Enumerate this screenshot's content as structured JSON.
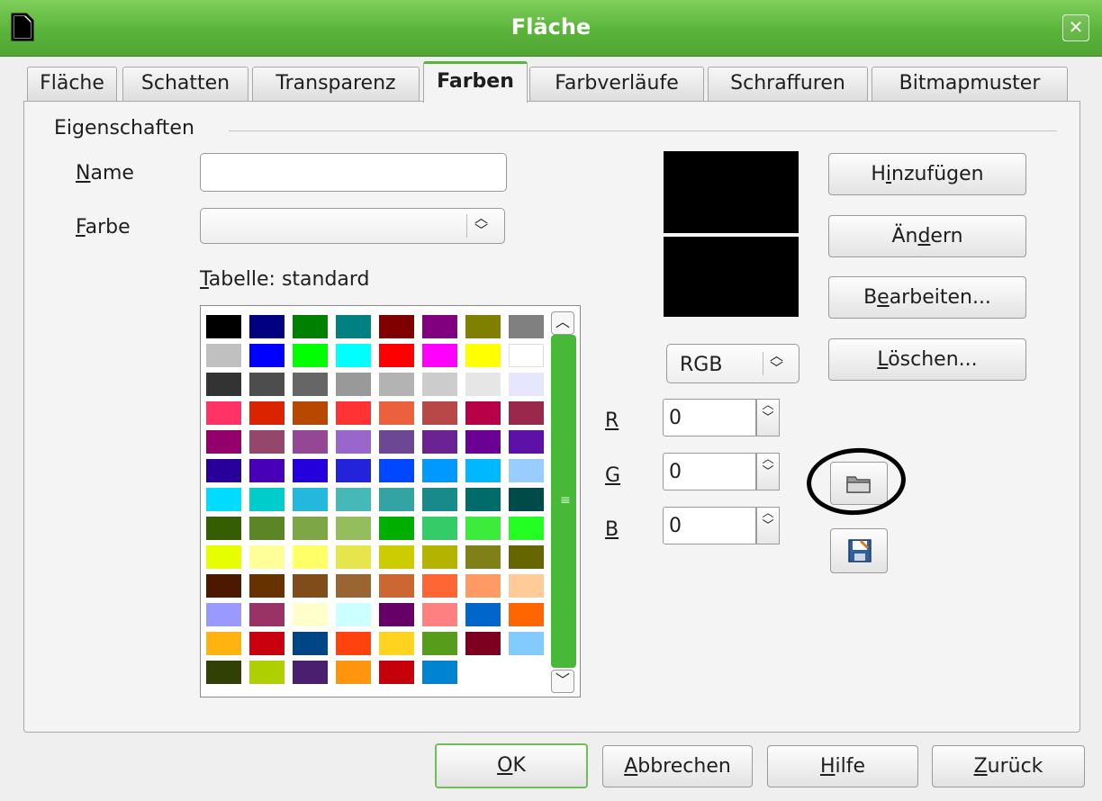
{
  "window": {
    "title": "Fläche"
  },
  "tabs": [
    {
      "label": "Fläche"
    },
    {
      "label": "Schatten"
    },
    {
      "label": "Transparenz"
    },
    {
      "label": "Farben"
    },
    {
      "label": "Farbverläufe"
    },
    {
      "label": "Schraffuren"
    },
    {
      "label": "Bitmapmuster"
    }
  ],
  "active_tab": "Farben",
  "properties": {
    "group_label": "Eigenschaften",
    "name_label": "Name",
    "name_value": "",
    "color_label": "Farbe",
    "color_value": "",
    "table_label": "Tabelle: standard"
  },
  "color_model": {
    "value": "RGB"
  },
  "rgb": {
    "r_label": "R",
    "r_value": "0",
    "g_label": "G",
    "g_value": "0",
    "b_label": "B",
    "b_value": "0"
  },
  "side_buttons": {
    "add": "Hinzufügen",
    "modify": "Ändern",
    "edit": "Bearbeiten...",
    "delete": "Löschen..."
  },
  "footer": {
    "ok": "OK",
    "cancel": "Abbrechen",
    "help": "Hilfe",
    "back": "Zurück"
  },
  "palette": [
    [
      "#000000",
      "#000080",
      "#008000",
      "#008080",
      "#800000",
      "#800080",
      "#808000",
      "#808080"
    ],
    [
      "#c0c0c0",
      "#0000ff",
      "#00ff00",
      "#00ffff",
      "#ff0000",
      "#ff00ff",
      "#ffff00",
      "#ffffff"
    ],
    [
      "#333333",
      "#4d4d4d",
      "#666666",
      "#999999",
      "#b3b3b3",
      "#cccccc",
      "#e6e6e6",
      "#e6e6ff"
    ],
    [
      "#ff3366",
      "#dc2300",
      "#b84700",
      "#ff3333",
      "#eb613d",
      "#b84747",
      "#b80047",
      "#99284c"
    ],
    [
      "#94006b",
      "#94476b",
      "#944794",
      "#9966cc",
      "#6b4794",
      "#6b2394",
      "#6b0094",
      "#5e11a6"
    ],
    [
      "#280099",
      "#4700b8",
      "#2300dc",
      "#2323dc",
      "#0047ff",
      "#0099ff",
      "#00b8ff",
      "#99ccff"
    ],
    [
      "#00dcff",
      "#00cccc",
      "#23b8dc",
      "#47b8b8",
      "#33a3a3",
      "#198a8a",
      "#006b6b",
      "#004a4a"
    ],
    [
      "#355e00",
      "#5c8526",
      "#7da647",
      "#94bd5e",
      "#00ae00",
      "#33cc66",
      "#3deb3d",
      "#23ff23"
    ],
    [
      "#e6ff00",
      "#ffff99",
      "#ffff66",
      "#e6e64c",
      "#cccc00",
      "#b3b300",
      "#808019",
      "#666600"
    ],
    [
      "#4c1900",
      "#663300",
      "#804c19",
      "#996633",
      "#cc6633",
      "#ff6633",
      "#ff9966",
      "#ffcc99"
    ],
    [
      "#9999ff",
      "#993366",
      "#ffffcc",
      "#ccffff",
      "#660066",
      "#ff8080",
      "#0066cc",
      "#ff6600"
    ],
    [
      "#ffb310",
      "#c9000e",
      "#004586",
      "#ff420e",
      "#ffd320",
      "#579d1c",
      "#7e0021",
      "#83caff"
    ],
    [
      "#314004",
      "#aecf00",
      "#4b1f6f",
      "#ff950e",
      "#c5000b",
      "#0084d1"
    ]
  ],
  "icons": {
    "open": "folder-open-icon",
    "save": "floppy-save-icon"
  }
}
